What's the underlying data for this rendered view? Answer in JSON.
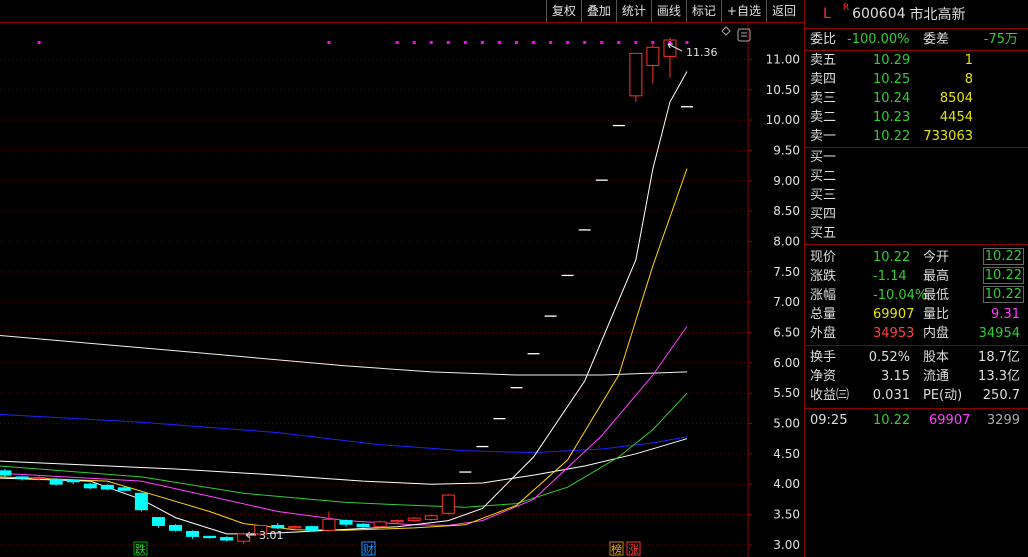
{
  "toolbar": {
    "buttons": [
      "复权",
      "叠加",
      "统计",
      "画线",
      "标记",
      "+自选",
      "返回"
    ]
  },
  "chart": {
    "price_labels": [
      "11.00",
      "10.50",
      "10.00",
      "9.50",
      "9.00",
      "8.50",
      "8.00",
      "7.50",
      "7.00",
      "6.50",
      "6.00",
      "5.50",
      "5.00",
      "4.50",
      "4.00",
      "3.50",
      "3.00"
    ],
    "high_label": "11.36",
    "low_label": "3.01",
    "events": [
      "跌",
      "财",
      "榜",
      "涨"
    ],
    "colors": {
      "up": "#ff3030",
      "down": "#00ffff",
      "ma5": "#ffffff",
      "ma10": "#ffd700",
      "ma20": "#ff40ff",
      "ma30": "#32cd32",
      "ma60": "#ffffff",
      "ma120": "#2020ff",
      "ma250": "#f0f0f0",
      "marker": "#ff00ff"
    }
  },
  "chart_data": {
    "type": "candlestick",
    "ylim": [
      2.8,
      11.6
    ],
    "candles": [
      {
        "o": 4.22,
        "c": 4.15,
        "h": 4.25,
        "l": 4.1
      },
      {
        "o": 4.12,
        "c": 4.1,
        "h": 4.14,
        "l": 4.06
      },
      {
        "o": 4.1,
        "c": 4.11,
        "h": 4.14,
        "l": 4.06
      },
      {
        "o": 4.08,
        "c": 4.0,
        "h": 4.1,
        "l": 3.98
      },
      {
        "o": 4.06,
        "c": 4.04,
        "h": 4.08,
        "l": 4.0
      },
      {
        "o": 4.0,
        "c": 3.94,
        "h": 4.02,
        "l": 3.92
      },
      {
        "o": 3.98,
        "c": 3.92,
        "h": 4.0,
        "l": 3.9
      },
      {
        "o": 3.94,
        "c": 3.9,
        "h": 3.96,
        "l": 3.88
      },
      {
        "o": 3.85,
        "c": 3.58,
        "h": 3.86,
        "l": 3.55
      },
      {
        "o": 3.45,
        "c": 3.32,
        "h": 3.46,
        "l": 3.28
      },
      {
        "o": 3.32,
        "c": 3.24,
        "h": 3.34,
        "l": 3.22
      },
      {
        "o": 3.22,
        "c": 3.14,
        "h": 3.24,
        "l": 3.1
      },
      {
        "o": 3.14,
        "c": 3.12,
        "h": 3.15,
        "l": 3.1
      },
      {
        "o": 3.12,
        "c": 3.08,
        "h": 3.14,
        "l": 3.06
      },
      {
        "o": 3.06,
        "c": 3.18,
        "h": 3.2,
        "l": 3.01
      },
      {
        "o": 3.18,
        "c": 3.32,
        "h": 3.33,
        "l": 3.15
      },
      {
        "o": 3.32,
        "c": 3.28,
        "h": 3.36,
        "l": 3.26
      },
      {
        "o": 3.28,
        "c": 3.3,
        "h": 3.32,
        "l": 3.25
      },
      {
        "o": 3.3,
        "c": 3.24,
        "h": 3.32,
        "l": 3.22
      },
      {
        "o": 3.24,
        "c": 3.42,
        "h": 3.55,
        "l": 3.22
      },
      {
        "o": 3.4,
        "c": 3.34,
        "h": 3.42,
        "l": 3.3
      },
      {
        "o": 3.34,
        "c": 3.3,
        "h": 3.36,
        "l": 3.28
      },
      {
        "o": 3.3,
        "c": 3.38,
        "h": 3.4,
        "l": 3.28
      },
      {
        "o": 3.38,
        "c": 3.4,
        "h": 3.42,
        "l": 3.35
      },
      {
        "o": 3.4,
        "c": 3.44,
        "h": 3.46,
        "l": 3.38
      },
      {
        "o": 3.42,
        "c": 3.48,
        "h": 3.5,
        "l": 3.4
      },
      {
        "o": 3.52,
        "c": 3.82,
        "h": 3.84,
        "l": 3.5
      },
      {
        "o": 4.2,
        "c": 4.2,
        "h": 4.2,
        "l": 4.2
      },
      {
        "o": 4.62,
        "c": 4.62,
        "h": 4.62,
        "l": 4.62
      },
      {
        "o": 5.08,
        "c": 5.08,
        "h": 5.08,
        "l": 5.08
      },
      {
        "o": 5.59,
        "c": 5.59,
        "h": 5.59,
        "l": 5.59
      },
      {
        "o": 6.15,
        "c": 6.15,
        "h": 6.15,
        "l": 6.15
      },
      {
        "o": 6.77,
        "c": 6.77,
        "h": 6.77,
        "l": 6.77
      },
      {
        "o": 7.44,
        "c": 7.44,
        "h": 7.44,
        "l": 7.44
      },
      {
        "o": 8.19,
        "c": 8.19,
        "h": 8.19,
        "l": 8.19
      },
      {
        "o": 9.01,
        "c": 9.01,
        "h": 9.01,
        "l": 9.01
      },
      {
        "o": 9.91,
        "c": 9.91,
        "h": 9.91,
        "l": 9.91
      },
      {
        "o": 10.4,
        "c": 11.1,
        "h": 11.1,
        "l": 10.3
      },
      {
        "o": 10.9,
        "c": 11.2,
        "h": 11.25,
        "l": 10.6
      },
      {
        "o": 11.05,
        "c": 11.32,
        "h": 11.36,
        "l": 10.7
      },
      {
        "o": 10.22,
        "c": 10.22,
        "h": 10.22,
        "l": 10.22
      }
    ],
    "ma5": [
      [
        0,
        4.1
      ],
      [
        5,
        4.05
      ],
      [
        8,
        3.75
      ],
      [
        10,
        3.45
      ],
      [
        13,
        3.18
      ],
      [
        15,
        3.18
      ],
      [
        19,
        3.24
      ],
      [
        23,
        3.3
      ],
      [
        26,
        3.4
      ],
      [
        28,
        3.6
      ],
      [
        31,
        4.45
      ],
      [
        34,
        5.7
      ],
      [
        37,
        7.7
      ],
      [
        38,
        9.2
      ],
      [
        39,
        10.3
      ],
      [
        40,
        10.8
      ]
    ],
    "ma10": [
      [
        0,
        4.12
      ],
      [
        6,
        4.05
      ],
      [
        9,
        3.8
      ],
      [
        12,
        3.55
      ],
      [
        14,
        3.35
      ],
      [
        17,
        3.25
      ],
      [
        20,
        3.24
      ],
      [
        24,
        3.28
      ],
      [
        27,
        3.33
      ],
      [
        30,
        3.65
      ],
      [
        33,
        4.4
      ],
      [
        36,
        5.8
      ],
      [
        38,
        7.6
      ],
      [
        40,
        9.2
      ]
    ],
    "ma20": [
      [
        0,
        4.18
      ],
      [
        8,
        4.05
      ],
      [
        12,
        3.8
      ],
      [
        16,
        3.55
      ],
      [
        20,
        3.4
      ],
      [
        24,
        3.33
      ],
      [
        26,
        3.32
      ],
      [
        28,
        3.4
      ],
      [
        31,
        3.75
      ],
      [
        35,
        4.8
      ],
      [
        38,
        5.8
      ],
      [
        40,
        6.6
      ]
    ],
    "ma30": [
      [
        0,
        4.3
      ],
      [
        8,
        4.12
      ],
      [
        14,
        3.85
      ],
      [
        20,
        3.7
      ],
      [
        24,
        3.65
      ],
      [
        27,
        3.62
      ],
      [
        30,
        3.68
      ],
      [
        33,
        3.95
      ],
      [
        36,
        4.45
      ],
      [
        38,
        4.9
      ],
      [
        40,
        5.5
      ]
    ],
    "ma60": [
      [
        0,
        4.38
      ],
      [
        10,
        4.25
      ],
      [
        16,
        4.15
      ],
      [
        21,
        4.05
      ],
      [
        25,
        4.0
      ],
      [
        28,
        4.02
      ],
      [
        31,
        4.15
      ],
      [
        34,
        4.3
      ],
      [
        37,
        4.5
      ],
      [
        40,
        4.75
      ]
    ],
    "ma120": [
      [
        0,
        5.15
      ],
      [
        8,
        5.02
      ],
      [
        16,
        4.85
      ],
      [
        22,
        4.65
      ],
      [
        27,
        4.55
      ],
      [
        31,
        4.52
      ],
      [
        35,
        4.58
      ],
      [
        38,
        4.68
      ],
      [
        40,
        4.78
      ]
    ],
    "ma250": [
      [
        0,
        6.45
      ],
      [
        10,
        6.2
      ],
      [
        20,
        5.95
      ],
      [
        25,
        5.85
      ],
      [
        30,
        5.8
      ],
      [
        35,
        5.8
      ],
      [
        40,
        5.85
      ]
    ],
    "markers": [
      2,
      19,
      23,
      24,
      25,
      26,
      27,
      28,
      29,
      30,
      31,
      32,
      33,
      34,
      35,
      36,
      37,
      38,
      39,
      40
    ]
  },
  "panel": {
    "mark": "L",
    "rmark": "R",
    "code": "600604",
    "name": "市北高新",
    "weibi_label": "委比",
    "weibi": "-100.00%",
    "weicha_label": "委差",
    "weicha": "-75万",
    "sell": [
      {
        "label": "卖五",
        "price": "10.29",
        "vol": "1"
      },
      {
        "label": "卖四",
        "price": "10.25",
        "vol": "8"
      },
      {
        "label": "卖三",
        "price": "10.24",
        "vol": "8504"
      },
      {
        "label": "卖二",
        "price": "10.23",
        "vol": "4454"
      },
      {
        "label": "卖一",
        "price": "10.22",
        "vol": "733063"
      }
    ],
    "buy": [
      "买一",
      "买二",
      "买三",
      "买四",
      "买五"
    ],
    "xianjia_label": "现价",
    "xianjia": "10.22",
    "jinkai_label": "今开",
    "jinkai": "10.22",
    "zhangdie_label": "涨跌",
    "zhangdie": "-1.14",
    "zuigao_label": "最高",
    "zuigao": "10.22",
    "zhangfu_label": "涨幅",
    "zhangfu": "-10.04%",
    "zuidi_label": "最低",
    "zuidi": "10.22",
    "zongliang_label": "总量",
    "zongliang": "69907",
    "liangbi_label": "量比",
    "liangbi": "9.31",
    "waipan_label": "外盘",
    "waipan": "34953",
    "neipan_label": "内盘",
    "neipan": "34954",
    "huanshou_label": "换手",
    "huanshou": "0.52%",
    "guben_label": "股本",
    "guben": "18.7亿",
    "jingzi_label": "净资",
    "jingzi": "3.15",
    "liutong_label": "流通",
    "liutong": "13.3亿",
    "shouyi_label": "收益㈢",
    "shouyi": "0.031",
    "pe_label": "PE(动)",
    "pe": "250.7",
    "tick_time": "09:25",
    "tick_price": "10.22",
    "tick_vol": "69907",
    "tick_num": "3299"
  }
}
